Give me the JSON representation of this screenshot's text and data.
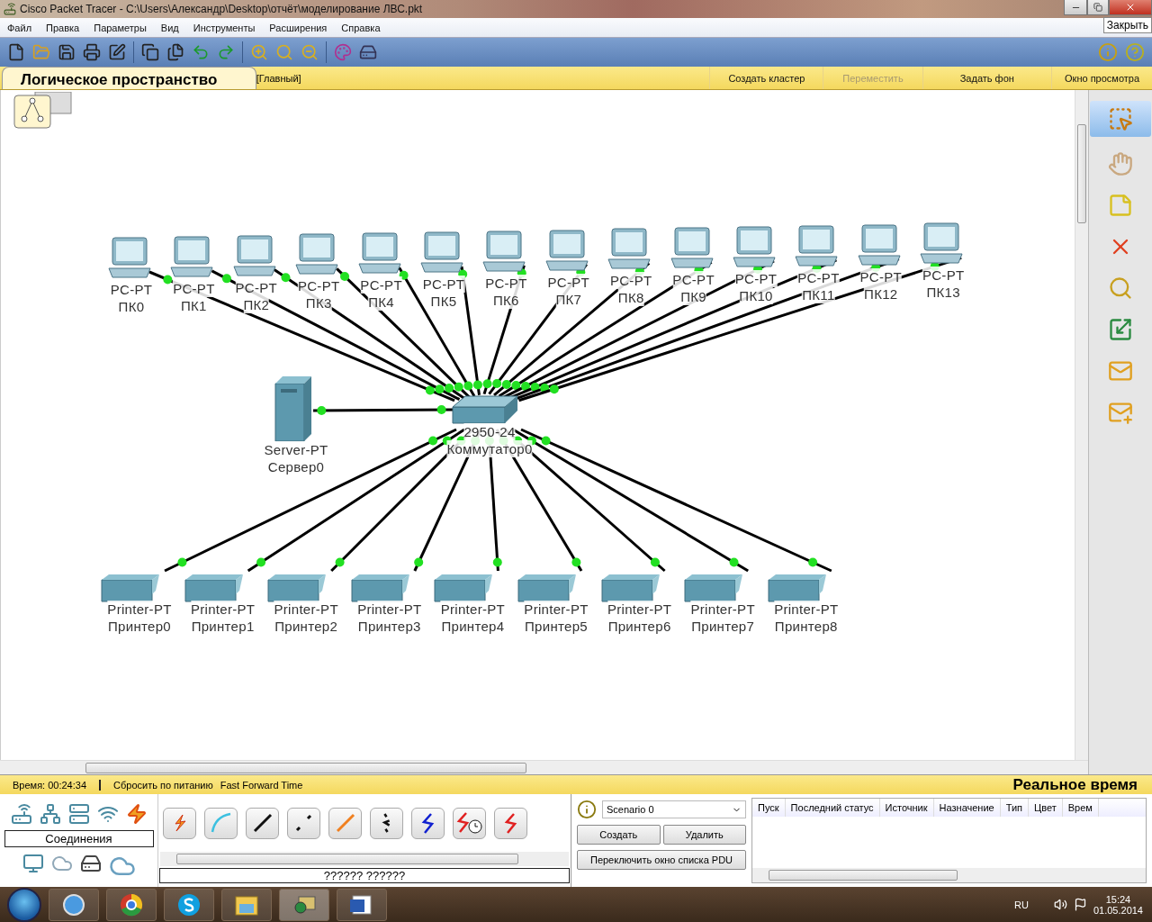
{
  "window": {
    "title": "Cisco Packet Tracer - C:\\Users\\Александр\\Desktop\\отчёт\\моделирование ЛВС.pkt",
    "tooltip": "Закрыть"
  },
  "menu": [
    "Файл",
    "Правка",
    "Параметры",
    "Вид",
    "Инструменты",
    "Расширения",
    "Справка"
  ],
  "workspace": {
    "title": "Логическое пространство",
    "tab": "[Главный]",
    "actions": [
      {
        "label": "Создать кластер",
        "disabled": false
      },
      {
        "label": "Переместить",
        "disabled": true
      },
      {
        "label": "Задать фон",
        "disabled": false
      },
      {
        "label": "Окно просмотра",
        "disabled": false
      }
    ]
  },
  "diagram": {
    "pcs": [
      {
        "model": "PC-PT",
        "name": "ПК0"
      },
      {
        "model": "PC-PT",
        "name": "ПК1"
      },
      {
        "model": "PC-PT",
        "name": "ПК2"
      },
      {
        "model": "PC-PT",
        "name": "ПК3"
      },
      {
        "model": "PC-PT",
        "name": "ПК4"
      },
      {
        "model": "PC-PT",
        "name": "ПК5"
      },
      {
        "model": "PC-PT",
        "name": "ПК6"
      },
      {
        "model": "PC-PT",
        "name": "ПК7"
      },
      {
        "model": "PC-PT",
        "name": "ПК8"
      },
      {
        "model": "PC-PT",
        "name": "ПК9"
      },
      {
        "model": "PC-PT",
        "name": "ПК10"
      },
      {
        "model": "PC-PT",
        "name": "ПК11"
      },
      {
        "model": "PC-PT",
        "name": "ПК12"
      },
      {
        "model": "PC-PT",
        "name": "ПК13"
      }
    ],
    "server": {
      "model": "Server-PT",
      "name": "Сервер0"
    },
    "switch": {
      "model": "2950-24",
      "name": "Коммутатор0"
    },
    "printers": [
      {
        "model": "Printer-PT",
        "name": "Принтер0"
      },
      {
        "model": "Printer-PT",
        "name": "Принтер1"
      },
      {
        "model": "Printer-PT",
        "name": "Принтер2"
      },
      {
        "model": "Printer-PT",
        "name": "Принтер3"
      },
      {
        "model": "Printer-PT",
        "name": "Принтер4"
      },
      {
        "model": "Printer-PT",
        "name": "Принтер5"
      },
      {
        "model": "Printer-PT",
        "name": "Принтер6"
      },
      {
        "model": "Printer-PT",
        "name": "Принтер7"
      },
      {
        "model": "Printer-PT",
        "name": "Принтер8"
      }
    ]
  },
  "status": {
    "time": "Время: 00:24:34",
    "buttons": [
      "Сбросить по питанию",
      "Fast Forward Time"
    ],
    "mode": "Реальное время"
  },
  "devices": {
    "category": "Соединения",
    "footer": "?????? ??????"
  },
  "scenario": {
    "name": "Scenario 0",
    "buttons": [
      "Создать",
      "Удалить"
    ],
    "toggle": "Переключить окно списка PDU"
  },
  "pdu_table": {
    "columns": [
      "Пуск",
      "Последний статус",
      "Источник",
      "Назначение",
      "Тип",
      "Цвет",
      "Врем"
    ]
  },
  "taskbar": {
    "lang": "RU",
    "time": "15:24",
    "date": "01.05.2014"
  }
}
